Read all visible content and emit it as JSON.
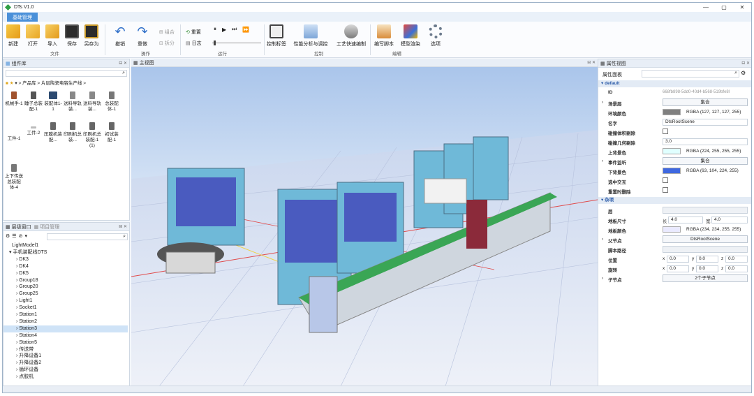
{
  "window": {
    "title": "DTs V1.0",
    "min": "—",
    "max": "▢",
    "close": "✕"
  },
  "ribbon_tab": "基础管理",
  "ribbon": {
    "file_buttons": [
      "新建",
      "打开",
      "导入",
      "保存",
      "另存为"
    ],
    "file_group": "文件",
    "op_buttons": [
      "撤销",
      "重做"
    ],
    "op_small": [
      "组合",
      "拆分"
    ],
    "op_group": "操作",
    "run_small": [
      "重置",
      "日志"
    ],
    "run_group": "运行",
    "control_buttons": [
      "控制标签",
      "性能分析与调控",
      "工艺快速编制"
    ],
    "control_group": "控制",
    "edit_buttons": [
      "编写脚本",
      "模型渲染",
      "选项"
    ],
    "edit_group": "编辑"
  },
  "library": {
    "title": "组件库",
    "breadcrumb": [
      "产品库",
      "片层陶瓷电容生产线"
    ],
    "items": [
      "机械手-1",
      "睡子总装配-1",
      "装配体1-1",
      "送料导轨装...",
      "送料导轨装...",
      "总装配体-1",
      "工件-1",
      "工件-2",
      "压膜机装配...",
      "印刷机总装...",
      "印刷机总装配-1 (1)",
      "初试装配-1",
      "上下传送总装配体-4"
    ]
  },
  "scene_tree": {
    "tabs": [
      "层级窗口",
      "项目管理"
    ],
    "items": [
      "LightModel1",
      "手机装配线DTS",
      "DK3",
      "DK4",
      "DK5",
      "Group18",
      "Group20",
      "Group25",
      "Light1",
      "Socket1",
      "Station1",
      "Station2",
      "Station3",
      "Station4",
      "Station5",
      "传送带",
      "升降设备1",
      "升降设备2",
      "循环设备",
      "点胶机"
    ],
    "selected": "Station3"
  },
  "viewport": {
    "title": "主视图"
  },
  "properties": {
    "title": "属性视图",
    "panel_label": "属性面板",
    "section_default": "default",
    "id_label": "ID",
    "id_value": "668fb898-5dd0-40d4-b568-519bfe8l",
    "skybox_label": "场景层",
    "skybox_value": "集合",
    "env_color_label": "环境颜色",
    "env_color_value": "RGBA (127, 127, 127, 255)",
    "name_label": "名字",
    "name_value": "DtsRootScene",
    "cull_label": "碰撞体积剔除",
    "lod_label": "碰撞几何剔除",
    "lod_value": "3.0",
    "top_color_label": "上背景色",
    "top_color_value": "RGBA (224, 255, 255, 255)",
    "event_label": "事件监听",
    "event_value": "集合",
    "bottom_color_label": "下背景色",
    "bottom_color_value": "RGBA (63, 104, 224, 255)",
    "pick_label": "选中交互",
    "reset_label": "重置时删除",
    "section_misc": "杂项",
    "layer_label": "层",
    "floor_size_label": "地板尺寸",
    "floor_len_prefix": "长",
    "floor_len": "4.0",
    "floor_wid_prefix": "宽",
    "floor_wid": "4.0",
    "floor_color_label": "地板颜色",
    "floor_color_value": "RGBA (234, 234, 255, 255)",
    "parent_label": "父节点",
    "parent_value": "DtsRootScene",
    "script_label": "脚本路径",
    "pos_label": "位置",
    "rot_label": "旋转",
    "xyz": [
      "x",
      "y",
      "z"
    ],
    "pos": [
      "0.0",
      "0.0",
      "0.0"
    ],
    "rot": [
      "0.0",
      "0.0",
      "0.0"
    ],
    "children_label": "子节点",
    "children_value": "2个子节点"
  },
  "colors": {
    "env": "#7f7f7f",
    "top": "#e0ffff",
    "bottom": "#3f68e0",
    "floor": "#eaeaff",
    "accent": "#4a90d9"
  }
}
